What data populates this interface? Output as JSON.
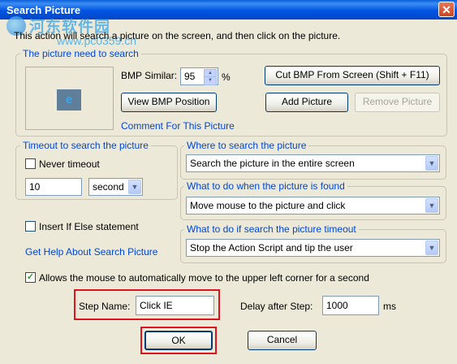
{
  "window": {
    "title": "Search Picture",
    "close_symbol": "✕"
  },
  "watermark": {
    "line1": "河东软件园",
    "line2": "www.pc0359.cn"
  },
  "description": "This action will search a picture on the screen, and then click on the picture.",
  "picture_group": {
    "label": "The picture need to search",
    "bmp_similar_label": "BMP Similar:",
    "bmp_similar_value": "95",
    "percent": "%",
    "view_bmp_button": "View BMP Position",
    "comment_link": "Comment For This Picture",
    "cut_bmp_button": "Cut BMP From Screen (Shift + F11)",
    "add_picture_button": "Add Picture",
    "remove_picture_button": "Remove Picture",
    "thumbnail_icon": "e"
  },
  "timeout_group": {
    "label": "Timeout to search the picture",
    "never_timeout_label": "Never timeout",
    "never_timeout_checked": false,
    "value": "10",
    "unit": "second"
  },
  "where_group": {
    "label": "Where to search the picture",
    "value": "Search the picture in the entire screen"
  },
  "found_group": {
    "label": "What to do when the picture is found",
    "value": "Move mouse to the picture and click"
  },
  "timeout_action_group": {
    "label": "What to do if search the picture timeout",
    "value": "Stop the Action Script and tip the user"
  },
  "insert_if_else": {
    "label": "Insert If Else statement",
    "checked": false
  },
  "help_link": "Get Help About Search Picture",
  "allow_mouse": {
    "label": "Allows the mouse to automatically move to the upper left corner for a second",
    "checked": true,
    "check_symbol": "✓"
  },
  "step": {
    "name_label": "Step Name:",
    "name_value": "Click IE",
    "delay_label": "Delay after Step:",
    "delay_value": "1000",
    "delay_unit": "ms"
  },
  "buttons": {
    "ok": "OK",
    "cancel": "Cancel"
  },
  "icons": {
    "dropdown_arrow": "▼",
    "spin_up": "▲",
    "spin_down": "▼"
  }
}
